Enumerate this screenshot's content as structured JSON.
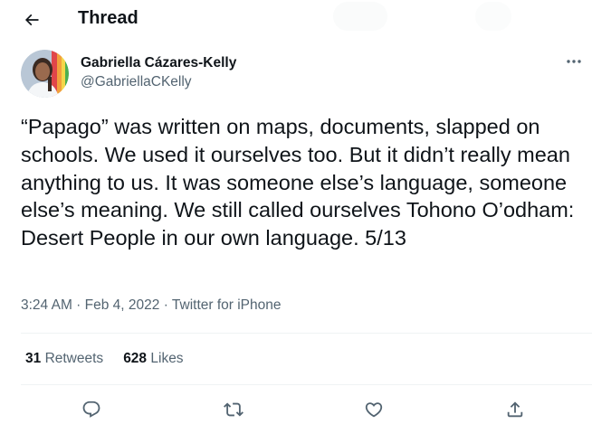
{
  "header": {
    "title": "Thread",
    "back_icon": "arrow-left-icon"
  },
  "author": {
    "name": "Gabriella Cázares-Kelly",
    "handle": "@GabriellaCKelly"
  },
  "tweet": {
    "text": "“Papago” was written on maps, documents, slapped on schools. We used it ourselves too. But it didn’t really mean anything to us. It was someone else’s language, someone else’s meaning. We still called ourselves Tohono O’odham: Desert People in our own language. 5/13"
  },
  "meta": {
    "time": "3:24 AM",
    "sep1": " · ",
    "date": "Feb 4, 2022",
    "sep2": " · ",
    "source": "Twitter for iPhone"
  },
  "stats": {
    "retweets_count": "31",
    "retweets_label": "Retweets",
    "likes_count": "628",
    "likes_label": "Likes"
  },
  "actions": [
    "reply-icon",
    "retweet-icon",
    "like-icon",
    "share-icon"
  ],
  "colors": {
    "text_primary": "#0f1419",
    "text_secondary": "#536471",
    "divider": "#eff3f4"
  }
}
